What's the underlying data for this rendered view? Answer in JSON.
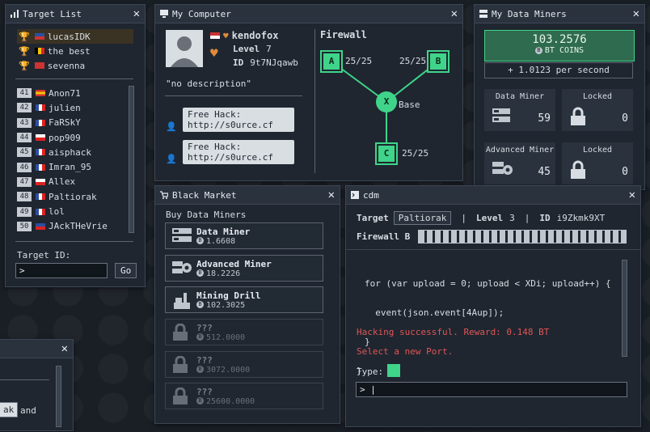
{
  "target_list": {
    "title": "Target List",
    "top": [
      {
        "name": "lucasIDK",
        "trophy": "gold"
      },
      {
        "name": "the best",
        "trophy": "silver"
      },
      {
        "name": "sevenna",
        "trophy": "bronze"
      }
    ],
    "ranked": [
      {
        "rank": "41",
        "name": "Anon71"
      },
      {
        "rank": "42",
        "name": "julien"
      },
      {
        "rank": "43",
        "name": "FaRSkY"
      },
      {
        "rank": "44",
        "name": "pop909"
      },
      {
        "rank": "45",
        "name": "aisphack"
      },
      {
        "rank": "46",
        "name": "Imran_95"
      },
      {
        "rank": "47",
        "name": "Allex"
      },
      {
        "rank": "48",
        "name": "Paltiorak"
      },
      {
        "rank": "49",
        "name": "lol"
      },
      {
        "rank": "50",
        "name": "JAckTHeVrie"
      }
    ],
    "target_id_label": "Target ID:",
    "target_id_value": ">",
    "go_label": "Go"
  },
  "my_computer": {
    "title": "My Computer",
    "username": "kendofox",
    "level_label": "Level",
    "level_value": "7",
    "id_label": "ID",
    "id_value": "9t7NJqawb",
    "description": "\"no description\"",
    "messages": [
      {
        "line1": "Free Hack:",
        "line2": "http://s0urce.cf"
      },
      {
        "line1": "Free Hack:",
        "line2": "http://s0urce.cf"
      }
    ],
    "firewall_label": "Firewall",
    "nodes": {
      "a": {
        "label": "A",
        "value": "25/25"
      },
      "b": {
        "label": "B",
        "value": "25/25"
      },
      "c": {
        "label": "C",
        "value": "25/25"
      },
      "x": {
        "label": "X",
        "value": "Base"
      }
    }
  },
  "data_miners": {
    "title": "My Data Miners",
    "balance": "103.2576",
    "currency": "BT COINS",
    "rate": "+ 1.0123 per second",
    "boxes": [
      {
        "label": "Data Miner",
        "value": "59",
        "icon": "server-icon"
      },
      {
        "label": "Locked",
        "value": "0",
        "icon": "lock-icon"
      },
      {
        "label": "Advanced Miner",
        "value": "45",
        "icon": "gear-server-icon"
      },
      {
        "label": "Locked",
        "value": "0",
        "icon": "lock-icon"
      }
    ]
  },
  "black_market": {
    "title": "Black Market",
    "section": "Buy Data Miners",
    "items": [
      {
        "name": "Data Miner",
        "price": "1.6608",
        "locked": false
      },
      {
        "name": "Advanced Miner",
        "price": "18.2226",
        "locked": false
      },
      {
        "name": "Mining Drill",
        "price": "102.3025",
        "locked": false
      },
      {
        "name": "???",
        "price": "512.0000",
        "locked": true
      },
      {
        "name": "???",
        "price": "3072.0000",
        "locked": true
      },
      {
        "name": "???",
        "price": "25600.0000",
        "locked": true
      }
    ]
  },
  "cdm": {
    "title": "cdm",
    "target_label": "Target",
    "target_value": "Paltiorak",
    "level_label": "Level",
    "level_value": "3",
    "id_label": "ID",
    "id_value": "i9Zkmk9XT",
    "firewall_label": "Firewall B",
    "code": [
      "for (var upload = 0; upload < XDi; upload++) {",
      "  event(json.event[4Aup]);",
      "}",
      "}"
    ],
    "success": "Hacking successful. Reward: 0.148 BT",
    "select": "Select a new Port.",
    "type_label": "Type:",
    "prompt": "> |"
  },
  "bottom_left": {
    "button": "ak",
    "text": "and"
  },
  "colors": {
    "accent_green": "#3fd48a",
    "error_red": "#e05555",
    "panel_bg": "#1f2630"
  }
}
